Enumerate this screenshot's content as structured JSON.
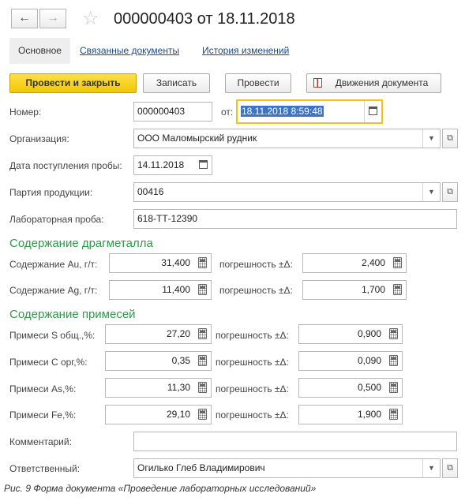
{
  "window": {
    "back_icon": "arrow-left-icon",
    "forward_icon": "arrow-right-icon",
    "favorite_icon": "star-icon",
    "title": "000000403 от 18.11.2018"
  },
  "tabs": {
    "main": "Основное",
    "related": "Связанные документы",
    "history": "История изменений"
  },
  "toolbar": {
    "post_close": "Провести и закрыть",
    "save": "Записать",
    "post": "Провести",
    "movements": "Движения документа",
    "accent": "#f4c600"
  },
  "form": {
    "number_label": "Номер:",
    "number_value": "000000403",
    "from_label": "от:",
    "date_value": "18.11.2018  8:59:48",
    "org_label": "Организация:",
    "org_value": "ООО Маломырский рудник",
    "sample_date_label": "Дата поступления пробы:",
    "sample_date_value": "14.11.2018",
    "batch_label": "Партия продукции:",
    "batch_value": "00416",
    "lab_sample_label": "Лабораторная проба:",
    "lab_sample_value": "618-ТТ-12390",
    "section_metal": "Содержание драгметалла",
    "au_label": "Содержание Au, г/т:",
    "au_value": "31,400",
    "au_err_label": "погрешность ±Δ:",
    "au_err_value": "2,400",
    "ag_label": "Содержание Ag, г/т:",
    "ag_value": "11,400",
    "ag_err_label": "погрешность ±Δ:",
    "ag_err_value": "1,700",
    "section_impurities": "Содержание примесей",
    "s_label": "Примеси S общ.,%:",
    "s_value": "27,20",
    "s_err_label": "погрешность ±Δ:",
    "s_err_value": "0,900",
    "c_label": "Примеси C орг,%:",
    "c_value": "0,35",
    "c_err_label": "погрешность ±Δ:",
    "c_err_value": "0,090",
    "as_label": "Примеси As,%:",
    "as_value": "11,30",
    "as_err_label": "погрешность ±Δ:",
    "as_err_value": "0,500",
    "fe_label": "Примеси Fe,%:",
    "fe_value": "29,10",
    "fe_err_label": "погрешность ±Δ:",
    "fe_err_value": "1,900",
    "comment_label": "Комментарий:",
    "comment_value": "",
    "responsible_label": "Ответственный:",
    "responsible_value": "Огилько Глеб Владимирович",
    "section_color": "#2e9a47"
  },
  "caption": "Рис. 9 Форма документа «Проведение лабораторных исследований»"
}
